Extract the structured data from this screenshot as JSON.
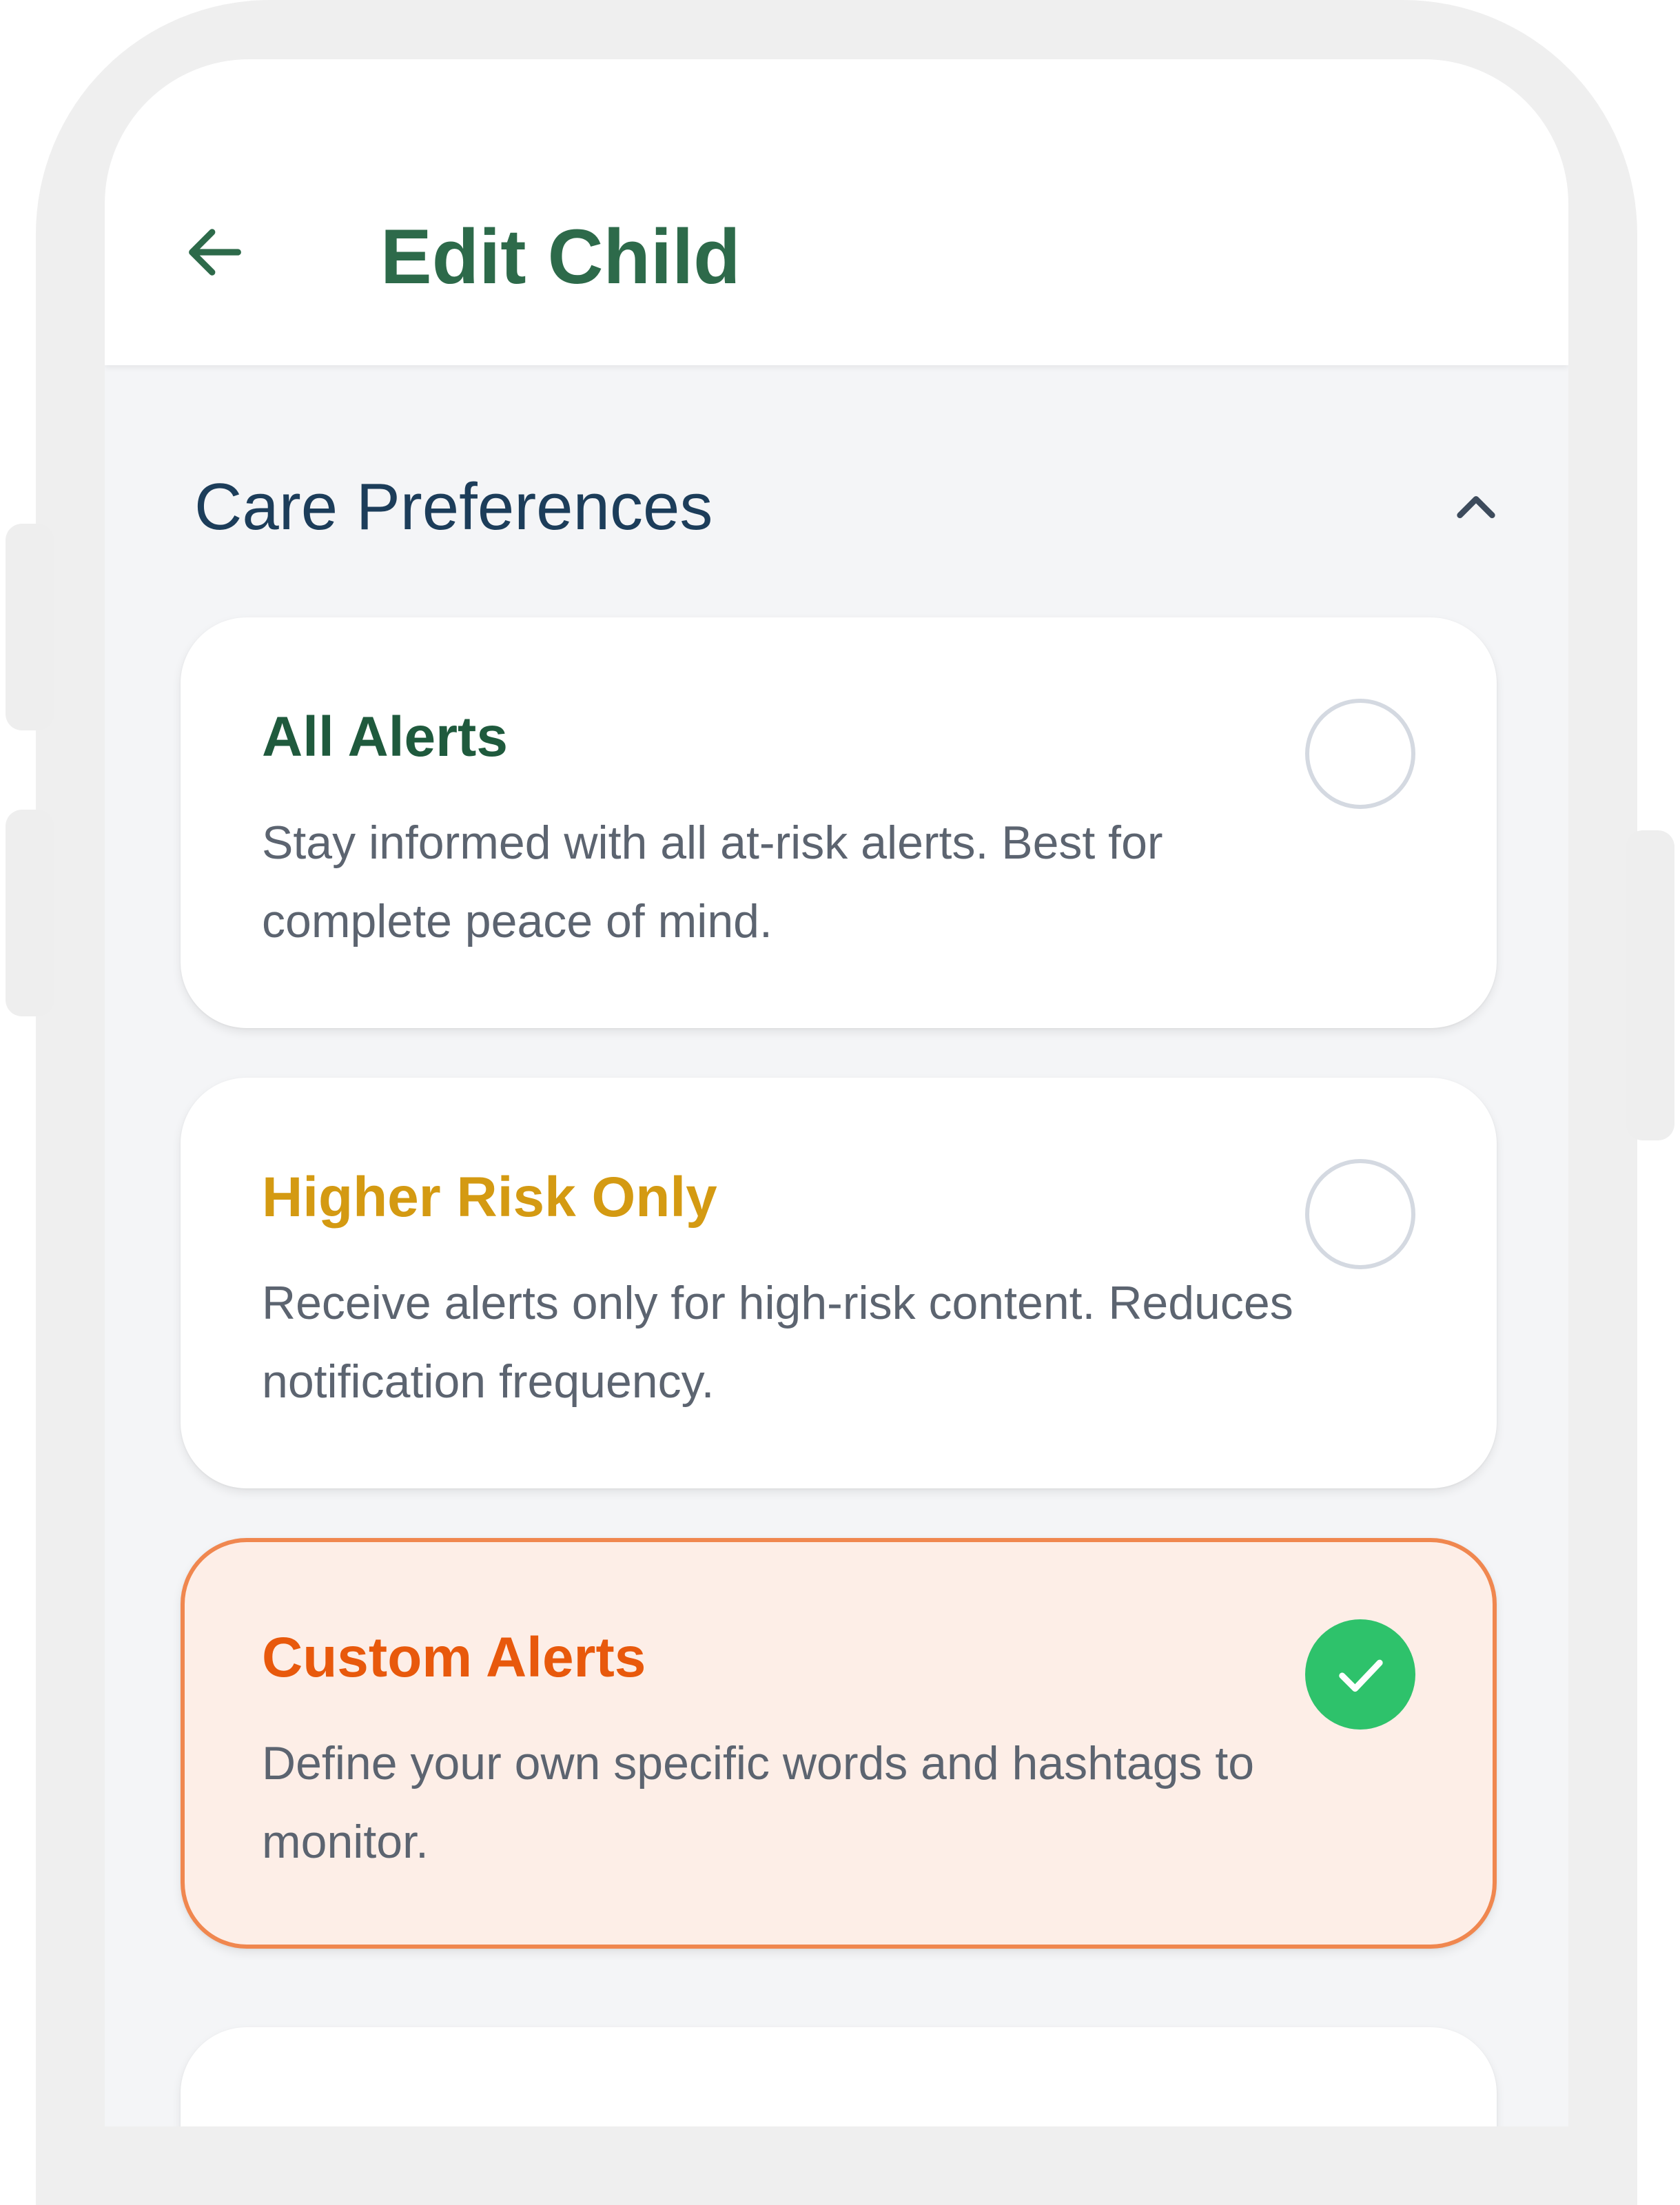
{
  "header": {
    "title": "Edit Child",
    "back_icon": "arrow-left-icon"
  },
  "section": {
    "title": "Care Preferences",
    "toggle_icon": "chevron-up-icon",
    "expanded": true
  },
  "options": [
    {
      "title": "All Alerts",
      "description": "Stay informed with all at-risk alerts. Best for complete peace of mind.",
      "selected": false,
      "title_color": "#1f5a3d"
    },
    {
      "title": "Higher Risk Only",
      "description": "Receive alerts only for high-risk content. Reduces notification frequency.",
      "selected": false,
      "title_color": "#d49a12"
    },
    {
      "title": "Custom Alerts",
      "description": "Define your own specific words and hashtags to monitor.",
      "selected": true,
      "title_color": "#e8590c"
    }
  ],
  "colors": {
    "primary_green": "#2d6a4a",
    "section_title": "#1c3d5a",
    "selected_border": "#f0874f",
    "selected_bg": "#fdeee7",
    "check_green": "#2ec26b"
  }
}
